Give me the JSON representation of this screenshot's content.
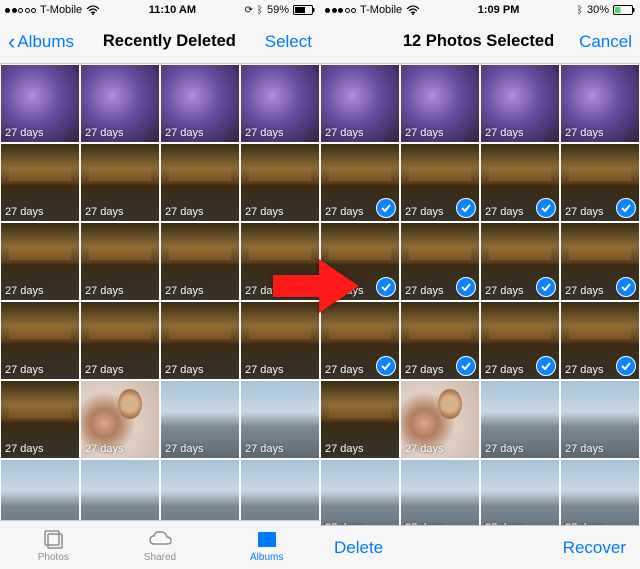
{
  "left": {
    "status": {
      "carrier": "T-Mobile",
      "time": "11:10 AM",
      "battery": "59%",
      "orientationLock": "⊛",
      "bluetooth": "✱"
    },
    "nav": {
      "back": "Albums",
      "title": "Recently Deleted",
      "action": "Select"
    },
    "badge": "27 days",
    "tabs": {
      "photos": "Photos",
      "shared": "Shared",
      "albums": "Albums"
    }
  },
  "right": {
    "status": {
      "carrier": "T-Mobile",
      "time": "1:09 PM",
      "battery": "30%",
      "bluetooth": "✱"
    },
    "nav": {
      "title": "12 Photos Selected",
      "action": "Cancel"
    },
    "badge": "27 days",
    "toolbar": {
      "delete": "Delete",
      "recover": "Recover"
    }
  }
}
